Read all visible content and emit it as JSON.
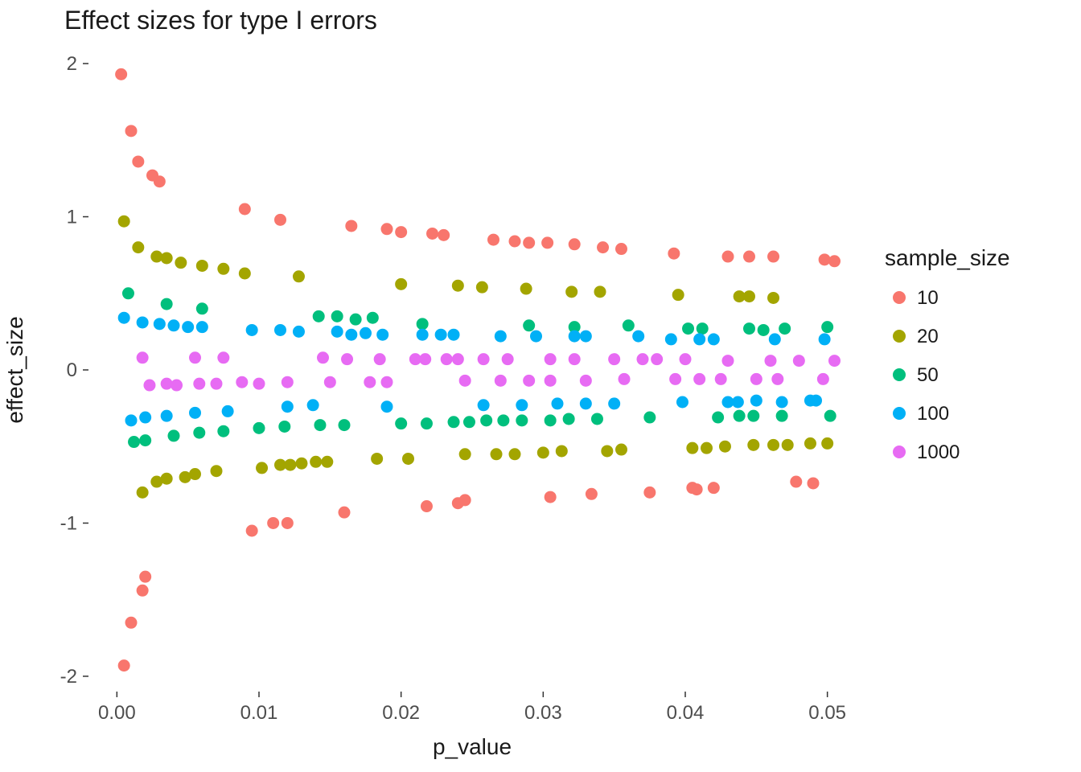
{
  "chart_data": {
    "type": "scatter",
    "title": "Effect sizes for type I errors",
    "xlabel": "p_value",
    "ylabel": "effect_size",
    "xlim": [
      -0.002,
      0.052
    ],
    "ylim": [
      -2.1,
      2.1
    ],
    "xticks": [
      0.0,
      0.01,
      0.02,
      0.03,
      0.04,
      0.05
    ],
    "yticks": [
      -2,
      -1,
      0,
      1,
      2
    ],
    "legend_title": "sample_size",
    "legend_position": "right",
    "series": [
      {
        "name": "10",
        "color": "#F8766D",
        "points": [
          [
            0.0003,
            1.93
          ],
          [
            0.0005,
            -1.93
          ],
          [
            0.001,
            1.56
          ],
          [
            0.001,
            -1.65
          ],
          [
            0.0015,
            1.36
          ],
          [
            0.0018,
            -1.44
          ],
          [
            0.002,
            -1.35
          ],
          [
            0.0025,
            1.27
          ],
          [
            0.003,
            1.23
          ],
          [
            0.0095,
            -1.05
          ],
          [
            0.009,
            1.05
          ],
          [
            0.011,
            -1.0
          ],
          [
            0.012,
            -1.0
          ],
          [
            0.0115,
            0.98
          ],
          [
            0.016,
            -0.93
          ],
          [
            0.0165,
            0.94
          ],
          [
            0.019,
            0.92
          ],
          [
            0.02,
            0.9
          ],
          [
            0.0218,
            -0.89
          ],
          [
            0.0222,
            0.89
          ],
          [
            0.023,
            0.88
          ],
          [
            0.024,
            -0.87
          ],
          [
            0.0245,
            -0.85
          ],
          [
            0.0265,
            0.85
          ],
          [
            0.028,
            0.84
          ],
          [
            0.029,
            0.83
          ],
          [
            0.0305,
            -0.83
          ],
          [
            0.0303,
            0.83
          ],
          [
            0.0322,
            0.82
          ],
          [
            0.0334,
            -0.81
          ],
          [
            0.0342,
            0.8
          ],
          [
            0.0355,
            0.79
          ],
          [
            0.0375,
            -0.8
          ],
          [
            0.0392,
            0.76
          ],
          [
            0.0408,
            -0.78
          ],
          [
            0.0405,
            -0.77
          ],
          [
            0.042,
            -0.77
          ],
          [
            0.043,
            0.74
          ],
          [
            0.0445,
            0.74
          ],
          [
            0.0462,
            0.74
          ],
          [
            0.049,
            -0.74
          ],
          [
            0.0478,
            -0.73
          ],
          [
            0.0498,
            0.72
          ],
          [
            0.0505,
            0.71
          ]
        ]
      },
      {
        "name": "20",
        "color": "#A3A500",
        "points": [
          [
            0.0005,
            0.97
          ],
          [
            0.0015,
            0.8
          ],
          [
            0.0018,
            -0.8
          ],
          [
            0.0028,
            0.74
          ],
          [
            0.0028,
            -0.73
          ],
          [
            0.0035,
            0.73
          ],
          [
            0.0035,
            -0.71
          ],
          [
            0.0045,
            0.7
          ],
          [
            0.0048,
            -0.7
          ],
          [
            0.0055,
            -0.68
          ],
          [
            0.006,
            0.68
          ],
          [
            0.0075,
            0.66
          ],
          [
            0.007,
            -0.66
          ],
          [
            0.009,
            0.63
          ],
          [
            0.0102,
            -0.64
          ],
          [
            0.0115,
            -0.62
          ],
          [
            0.0122,
            -0.62
          ],
          [
            0.013,
            -0.61
          ],
          [
            0.0128,
            0.61
          ],
          [
            0.014,
            -0.6
          ],
          [
            0.0148,
            -0.6
          ],
          [
            0.0183,
            -0.58
          ],
          [
            0.02,
            0.56
          ],
          [
            0.0205,
            -0.58
          ],
          [
            0.024,
            0.55
          ],
          [
            0.0245,
            -0.55
          ],
          [
            0.0257,
            0.54
          ],
          [
            0.0267,
            -0.55
          ],
          [
            0.028,
            -0.55
          ],
          [
            0.0288,
            0.53
          ],
          [
            0.03,
            -0.54
          ],
          [
            0.0313,
            -0.53
          ],
          [
            0.032,
            0.51
          ],
          [
            0.034,
            0.51
          ],
          [
            0.0345,
            -0.53
          ],
          [
            0.0355,
            -0.52
          ],
          [
            0.0395,
            0.49
          ],
          [
            0.0405,
            -0.51
          ],
          [
            0.0415,
            -0.51
          ],
          [
            0.0428,
            -0.5
          ],
          [
            0.0438,
            0.48
          ],
          [
            0.0445,
            0.48
          ],
          [
            0.0448,
            -0.49
          ],
          [
            0.0462,
            0.47
          ],
          [
            0.0462,
            -0.49
          ],
          [
            0.0472,
            -0.49
          ],
          [
            0.0488,
            -0.48
          ],
          [
            0.05,
            -0.48
          ]
        ]
      },
      {
        "name": "50",
        "color": "#00BF7D",
        "points": [
          [
            0.0008,
            0.5
          ],
          [
            0.0012,
            -0.47
          ],
          [
            0.002,
            -0.46
          ],
          [
            0.0035,
            0.43
          ],
          [
            0.004,
            -0.43
          ],
          [
            0.006,
            0.4
          ],
          [
            0.0058,
            -0.41
          ],
          [
            0.0075,
            -0.4
          ],
          [
            0.01,
            -0.38
          ],
          [
            0.0118,
            -0.37
          ],
          [
            0.0142,
            0.35
          ],
          [
            0.0143,
            -0.36
          ],
          [
            0.0155,
            0.35
          ],
          [
            0.0168,
            0.33
          ],
          [
            0.016,
            -0.36
          ],
          [
            0.018,
            0.34
          ],
          [
            0.02,
            -0.35
          ],
          [
            0.0218,
            -0.35
          ],
          [
            0.0215,
            0.3
          ],
          [
            0.0237,
            -0.34
          ],
          [
            0.0248,
            -0.34
          ],
          [
            0.026,
            -0.33
          ],
          [
            0.0272,
            -0.33
          ],
          [
            0.0285,
            -0.33
          ],
          [
            0.029,
            0.29
          ],
          [
            0.0305,
            -0.33
          ],
          [
            0.0318,
            -0.32
          ],
          [
            0.0322,
            0.28
          ],
          [
            0.0338,
            -0.32
          ],
          [
            0.036,
            0.29
          ],
          [
            0.0375,
            -0.31
          ],
          [
            0.0402,
            0.27
          ],
          [
            0.0412,
            0.27
          ],
          [
            0.0423,
            -0.31
          ],
          [
            0.0438,
            -0.3
          ],
          [
            0.0448,
            -0.3
          ],
          [
            0.0445,
            0.27
          ],
          [
            0.0455,
            0.26
          ],
          [
            0.047,
            0.27
          ],
          [
            0.0468,
            -0.3
          ],
          [
            0.05,
            0.28
          ],
          [
            0.0502,
            -0.3
          ]
        ]
      },
      {
        "name": "100",
        "color": "#00B0F6",
        "points": [
          [
            0.0005,
            0.34
          ],
          [
            0.001,
            -0.33
          ],
          [
            0.0018,
            0.31
          ],
          [
            0.002,
            -0.31
          ],
          [
            0.003,
            0.3
          ],
          [
            0.0035,
            -0.3
          ],
          [
            0.004,
            0.29
          ],
          [
            0.005,
            0.28
          ],
          [
            0.0055,
            -0.28
          ],
          [
            0.006,
            0.28
          ],
          [
            0.0078,
            -0.27
          ],
          [
            0.0095,
            0.26
          ],
          [
            0.0115,
            0.26
          ],
          [
            0.012,
            -0.24
          ],
          [
            0.0128,
            0.25
          ],
          [
            0.0138,
            -0.23
          ],
          [
            0.0155,
            0.25
          ],
          [
            0.0165,
            0.23
          ],
          [
            0.0175,
            0.24
          ],
          [
            0.0187,
            0.23
          ],
          [
            0.019,
            -0.24
          ],
          [
            0.0215,
            0.23
          ],
          [
            0.0228,
            0.23
          ],
          [
            0.0237,
            0.23
          ],
          [
            0.0258,
            -0.23
          ],
          [
            0.027,
            0.22
          ],
          [
            0.0285,
            -0.23
          ],
          [
            0.0295,
            0.22
          ],
          [
            0.031,
            -0.22
          ],
          [
            0.0322,
            0.22
          ],
          [
            0.033,
            -0.22
          ],
          [
            0.033,
            0.22
          ],
          [
            0.035,
            -0.22
          ],
          [
            0.0367,
            0.22
          ],
          [
            0.039,
            0.2
          ],
          [
            0.0398,
            -0.21
          ],
          [
            0.041,
            0.2
          ],
          [
            0.042,
            0.2
          ],
          [
            0.043,
            -0.21
          ],
          [
            0.0437,
            -0.21
          ],
          [
            0.045,
            -0.2
          ],
          [
            0.0463,
            0.2
          ],
          [
            0.0468,
            -0.21
          ],
          [
            0.0488,
            -0.2
          ],
          [
            0.0498,
            0.2
          ],
          [
            0.0492,
            -0.2
          ]
        ]
      },
      {
        "name": "1000",
        "color": "#E76BF3",
        "points": [
          [
            0.0018,
            0.08
          ],
          [
            0.0023,
            -0.1
          ],
          [
            0.0035,
            -0.09
          ],
          [
            0.0042,
            -0.1
          ],
          [
            0.0055,
            0.08
          ],
          [
            0.0058,
            -0.09
          ],
          [
            0.0075,
            0.08
          ],
          [
            0.007,
            -0.09
          ],
          [
            0.0088,
            -0.08
          ],
          [
            0.01,
            -0.09
          ],
          [
            0.012,
            -0.08
          ],
          [
            0.0145,
            0.08
          ],
          [
            0.015,
            -0.08
          ],
          [
            0.0162,
            0.07
          ],
          [
            0.0178,
            -0.08
          ],
          [
            0.0185,
            0.07
          ],
          [
            0.019,
            -0.08
          ],
          [
            0.021,
            0.07
          ],
          [
            0.0217,
            0.07
          ],
          [
            0.0232,
            0.07
          ],
          [
            0.024,
            0.07
          ],
          [
            0.0245,
            -0.07
          ],
          [
            0.0275,
            0.07
          ],
          [
            0.0258,
            0.07
          ],
          [
            0.027,
            -0.07
          ],
          [
            0.029,
            -0.07
          ],
          [
            0.0305,
            0.07
          ],
          [
            0.0305,
            -0.07
          ],
          [
            0.0322,
            0.07
          ],
          [
            0.033,
            -0.07
          ],
          [
            0.035,
            0.07
          ],
          [
            0.0357,
            -0.06
          ],
          [
            0.037,
            0.07
          ],
          [
            0.038,
            0.07
          ],
          [
            0.0393,
            -0.06
          ],
          [
            0.04,
            0.07
          ],
          [
            0.041,
            -0.06
          ],
          [
            0.0425,
            -0.06
          ],
          [
            0.043,
            0.06
          ],
          [
            0.045,
            -0.06
          ],
          [
            0.046,
            0.06
          ],
          [
            0.0465,
            -0.06
          ],
          [
            0.048,
            0.06
          ],
          [
            0.0497,
            -0.06
          ],
          [
            0.0505,
            0.06
          ]
        ]
      }
    ]
  },
  "legend": {
    "title": "sample_size",
    "items": [
      "10",
      "20",
      "50",
      "100",
      "1000"
    ]
  },
  "title": "Effect sizes for type I errors",
  "xlabel": "p_value",
  "ylabel": "effect_size",
  "xtick_labels": [
    "0.00",
    "0.01",
    "0.02",
    "0.03",
    "0.04",
    "0.05"
  ],
  "ytick_labels": [
    "-2",
    "-1",
    "0",
    "1",
    "2"
  ]
}
